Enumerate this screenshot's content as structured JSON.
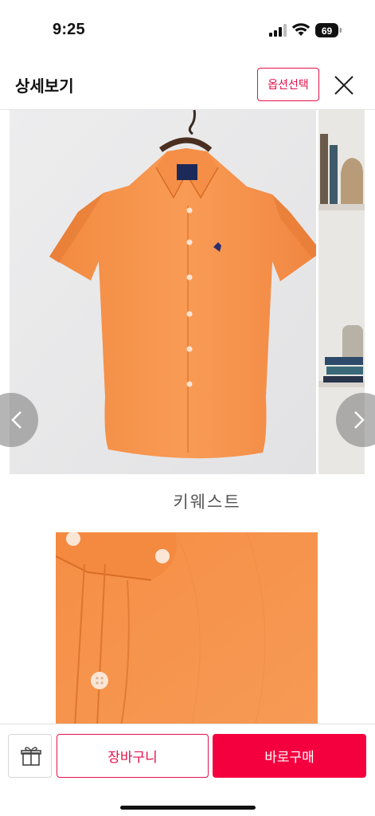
{
  "status_bar": {
    "time": "9:25",
    "battery": "69",
    "icons": [
      "signal-icon",
      "wifi-icon",
      "battery-icon"
    ]
  },
  "header": {
    "title": "상세보기",
    "option_button": "옵션선택",
    "close_icon": "close-icon"
  },
  "carousel": {
    "prev_icon": "chevron-left-icon",
    "next_icon": "chevron-right-icon"
  },
  "product": {
    "caption": "키웨스트"
  },
  "bottom_bar": {
    "gift_icon": "gift-icon",
    "cart_label": "장바구니",
    "buy_label": "바로구매"
  },
  "colors": {
    "accent": "#e4114b",
    "buy_button": "#f5003f",
    "shirt": "#f7934a"
  }
}
